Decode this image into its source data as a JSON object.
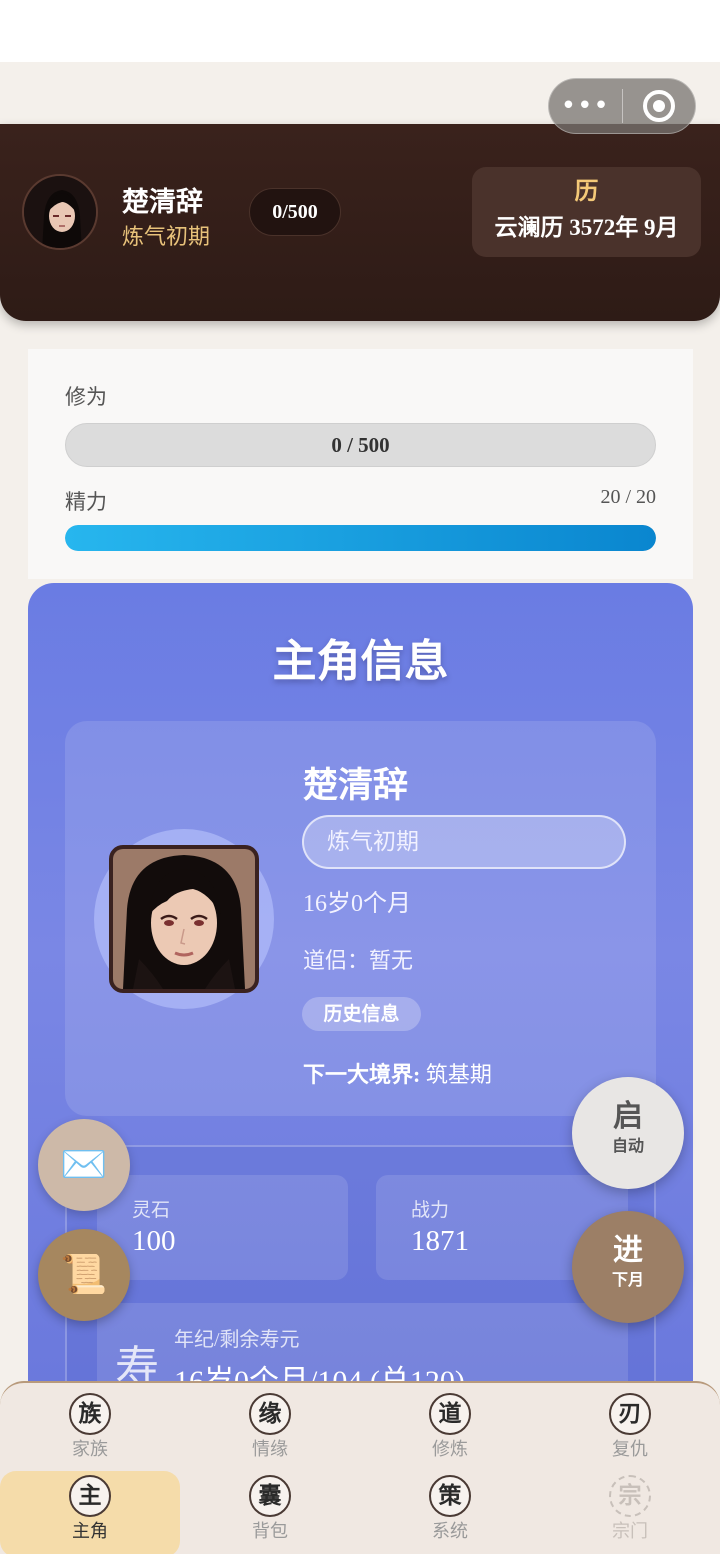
{
  "header": {
    "name": "楚清辞",
    "realm": "炼气初期",
    "xp": "0/500",
    "calendar_icon": "历",
    "date": "云澜历 3572年 9月"
  },
  "capsule": {
    "more_icon": "•••",
    "close_icon": "target-circle-icon"
  },
  "stats": {
    "cultivation_label": "修为",
    "cultivation_value": "0 / 500",
    "cultivation_fraction": 0,
    "energy_label": "精力",
    "energy_value": "20 / 20",
    "energy_fraction": 1.0
  },
  "profile": {
    "title": "主角信息",
    "name": "楚清辞",
    "realm": "炼气初期",
    "age": "16岁0个月",
    "partner": "道侣：暂无",
    "history_button": "历史信息",
    "next_realm_label": "下一大境界:",
    "next_realm_value": "筑基期"
  },
  "resources": {
    "spirit_stone_label": "灵石",
    "spirit_stone_value": "100",
    "power_label": "战力",
    "power_value": "1871",
    "life_glyph": "寿",
    "life_label": "年纪/剩余寿元",
    "life_value": "16岁0个月/104 (总120)"
  },
  "fabs": {
    "mail_icon": "✉️",
    "scroll_icon": "📜",
    "auto_main": "启",
    "auto_sub": "自动",
    "next_main": "进",
    "next_sub": "下月"
  },
  "tabs": [
    {
      "icon": "族",
      "label": "家族"
    },
    {
      "icon": "缘",
      "label": "情缘"
    },
    {
      "icon": "道",
      "label": "修炼"
    },
    {
      "icon": "刃",
      "label": "复仇"
    },
    {
      "icon": "主",
      "label": "主角",
      "active": true
    },
    {
      "icon": "囊",
      "label": "背包"
    },
    {
      "icon": "策",
      "label": "系统"
    },
    {
      "icon": "宗",
      "label": "宗门",
      "disabled": true
    }
  ],
  "colors": {
    "header_bg": "#2e1b16",
    "realm_gold": "#e8c27a",
    "energy_bar": "#1a9ee0",
    "profile_bg": "#6a7ce3",
    "tab_active_bg": "#f5dcaa"
  }
}
